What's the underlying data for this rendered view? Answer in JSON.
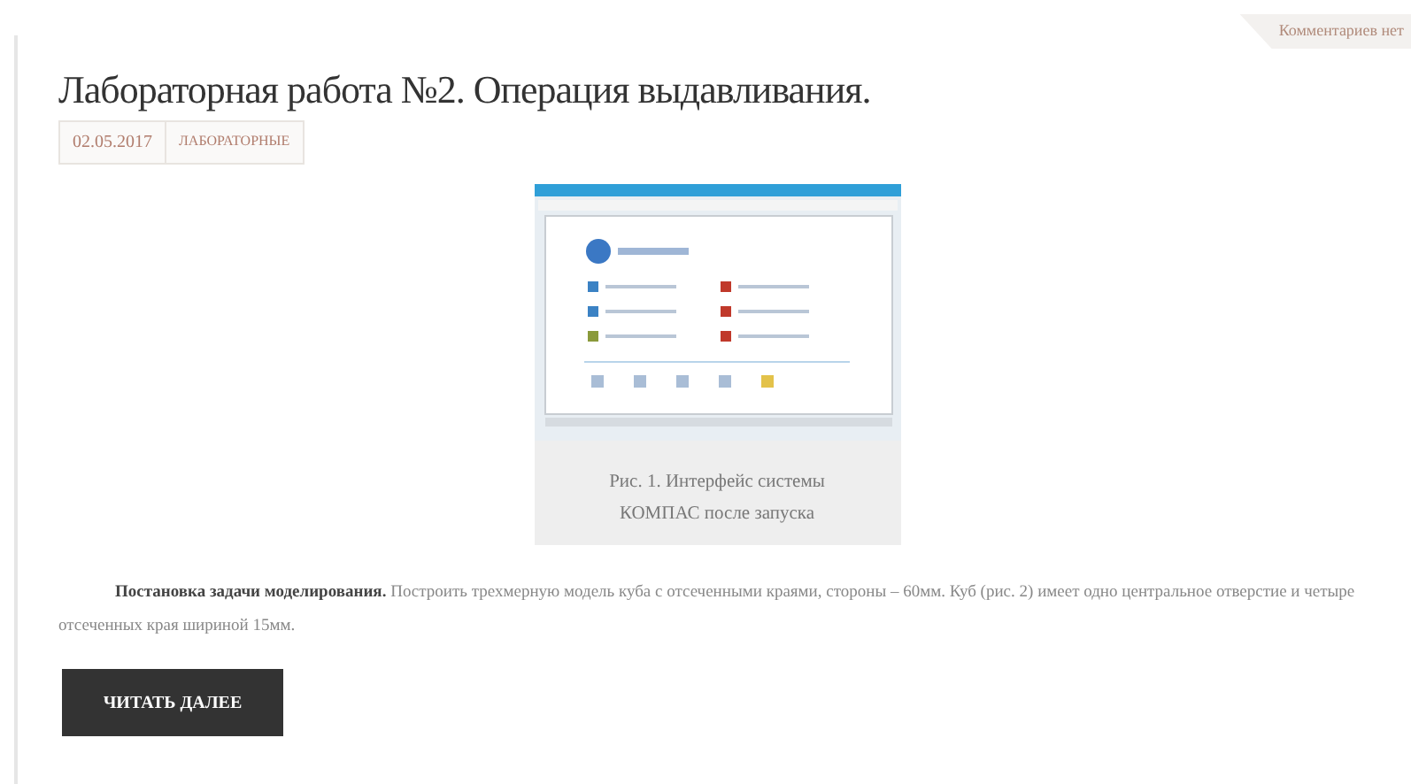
{
  "comments_tag": "Комментариев нет",
  "post": {
    "title": "Лабораторная работа №2. Операция выдавливания.",
    "date": "02.05.2017",
    "category": "ЛАБОРАТОРНЫЕ",
    "figure": {
      "caption": "Рис. 1. Интерфейс системы КОМПАС после запуска"
    },
    "paragraph": "**Постановка задачи моделирования.** Построить трехмерную модель куба с отсеченными краями, стороны – 60мм. Куб (рис. 2) имеет одно центральное отверстие и четыре отсеченных края шириной 15мм.",
    "read_more": "ЧИТАТЬ ДАЛЕЕ"
  }
}
